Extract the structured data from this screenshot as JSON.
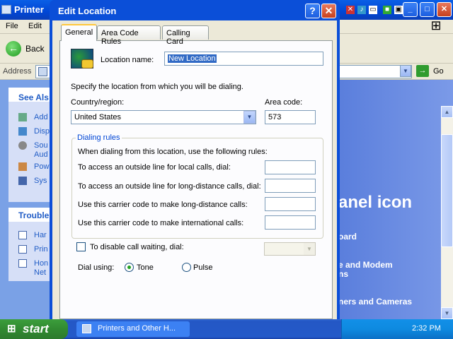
{
  "background": {
    "window_title": "Printer",
    "menu": {
      "file": "File",
      "edit": "Edit"
    },
    "back_label": "Back",
    "address_label": "Address",
    "go_label": "Go",
    "see_also": "See Als",
    "see_also_items": [
      "Add",
      "Disp",
      "Sou",
      "Aud",
      "Pow",
      "Sys"
    ],
    "troubleshoot": "Trouble",
    "trouble_items": [
      "Har",
      "Prin",
      "Hon",
      "Net"
    ],
    "panel_heading": "anel icon",
    "links": [
      "oard",
      "e and Modem",
      "ns",
      "ners and Cameras"
    ]
  },
  "dialog": {
    "title": "Edit Location",
    "help": "?",
    "close": "✕",
    "tabs": [
      "General",
      "Area Code Rules",
      "Calling Card"
    ],
    "location_name_label": "Location name:",
    "location_name_value": "New Location",
    "instruction": "Specify the location from which you will be dialing.",
    "country_label": "Country/region:",
    "country_value": "United States",
    "area_code_label": "Area code:",
    "area_code_value": "573",
    "group_title": "Dialing rules",
    "rules_intro": "When dialing from this location, use the following rules:",
    "rules": [
      "To access an outside line for local calls, dial:",
      "To access an outside line for long-distance calls, dial:",
      "Use this carrier code to make long-distance calls:",
      "Use this carrier code to make international calls:"
    ],
    "call_waiting_label": "To disable call waiting, dial:",
    "dial_using_label": "Dial using:",
    "tone_label": "Tone",
    "pulse_label": "Pulse"
  },
  "taskbar": {
    "start": "start",
    "task": "Printers and Other H...",
    "clock": "2:32 PM"
  }
}
